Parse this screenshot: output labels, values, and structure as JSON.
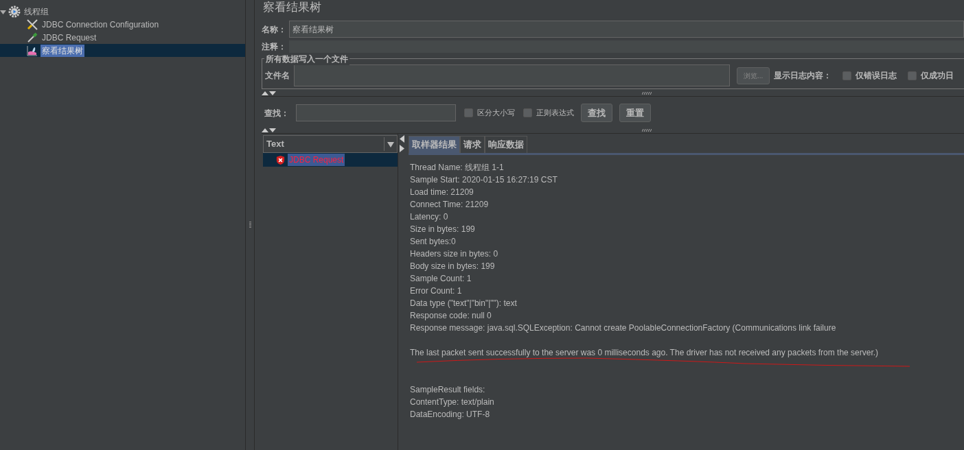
{
  "tree": {
    "items": [
      {
        "label": "线程组",
        "kind": "group",
        "expanded": true,
        "selected": false,
        "children": [
          {
            "label": "JDBC Connection Configuration",
            "kind": "config",
            "selected": false
          },
          {
            "label": "JDBC Request",
            "kind": "sampler",
            "selected": false
          },
          {
            "label": "察看结果树",
            "kind": "listener",
            "selected": true
          }
        ]
      }
    ]
  },
  "panel": {
    "title": "察看结果树",
    "name_label": "名称：",
    "name_value": "察看结果树",
    "comment_label": "注释：",
    "file_group": {
      "legend": "所有数据写入一个文件",
      "file_label": "文件名",
      "browse": "浏览...",
      "log_label": "显示日志内容：",
      "options": [
        {
          "label": "仅错误日志",
          "checked": false
        },
        {
          "label": "仅成功日",
          "checked": false
        }
      ]
    },
    "search": {
      "label": "查找：",
      "options": [
        {
          "label": "区分大小写",
          "checked": false
        },
        {
          "label": "正则表达式",
          "checked": false
        }
      ],
      "buttons": [
        "查找",
        "重置"
      ]
    },
    "renderer": "Text",
    "results": [
      {
        "label": "JDBC Request",
        "error": true,
        "selected": true
      }
    ],
    "tabs": [
      {
        "label": "取样器结果",
        "selected": true
      },
      {
        "label": "请求",
        "selected": false
      },
      {
        "label": "响应数据",
        "selected": false
      }
    ],
    "sections": [
      [
        "Thread Name: 线程组 1-1",
        "Sample Start: 2020-01-15 16:27:19 CST",
        "Load time: 21209",
        "Connect Time: 21209",
        "Latency: 0",
        "Size in bytes: 199",
        "Sent bytes:0",
        "Headers size in bytes: 0",
        "Body size in bytes: 199",
        "Sample Count: 1",
        "Error Count: 1",
        "Data type (\"text\"|\"bin\"|\"\"): text",
        "Response code: null 0",
        "Response message: java.sql.SQLException: Cannot create PoolableConnectionFactory (Communications link failure"
      ],
      [
        "The last packet sent successfully to the server was 0 milliseconds ago. The driver has not received any packets from the server.)"
      ],
      [
        "SampleResult fields:",
        "ContentType: text/plain",
        "DataEncoding: UTF-8"
      ]
    ]
  }
}
